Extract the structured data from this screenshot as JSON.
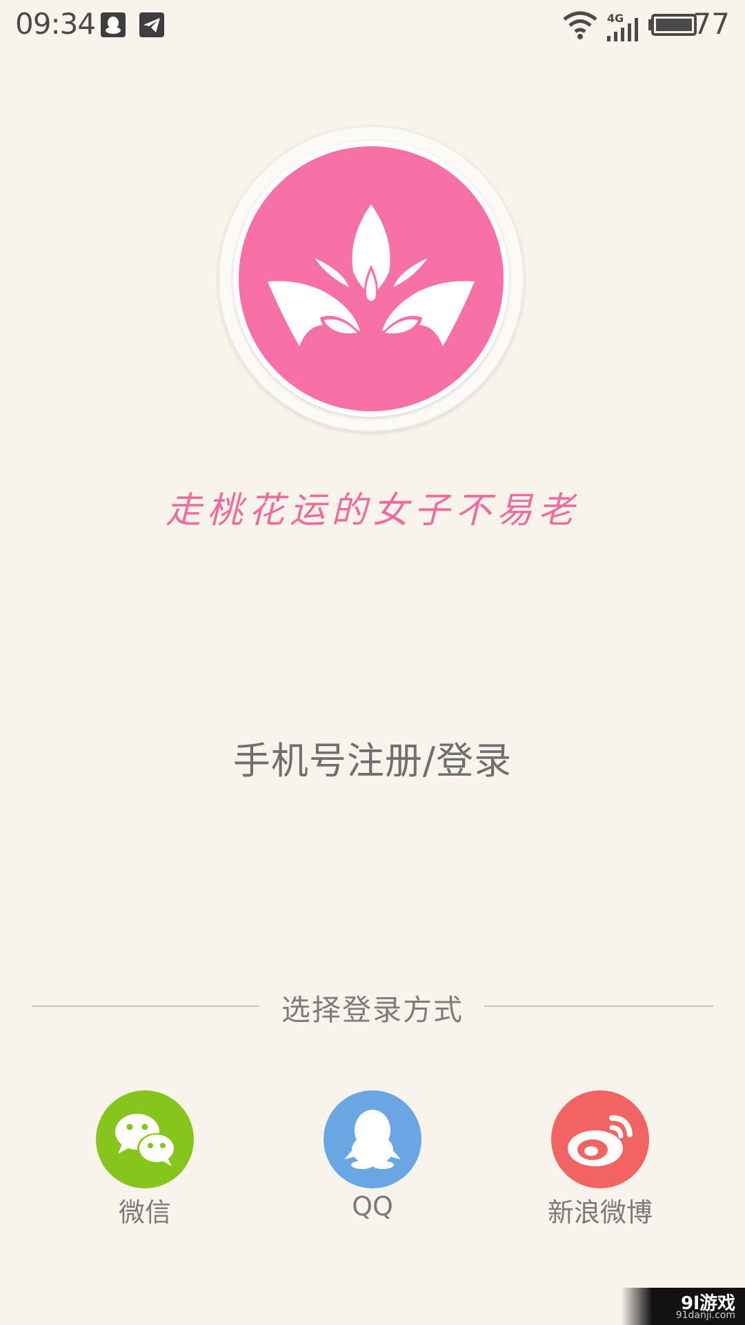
{
  "status_bar": {
    "time": "09:34",
    "network": "4G",
    "battery_level": "77",
    "icons": [
      "qq-notification-icon",
      "telegram-icon",
      "wifi-icon",
      "cellular-signal-icon",
      "battery-icon"
    ]
  },
  "logo": {
    "icon": "lotus-icon",
    "disc_color": "#f771a6"
  },
  "slogan": "走桃花运的女子不易老",
  "phone_login_label": "手机号注册/登录",
  "login_methods": {
    "title": "选择登录方式",
    "options": [
      {
        "label": "微信",
        "icon": "wechat-icon",
        "color": "#86c51b"
      },
      {
        "label": "QQ",
        "icon": "qq-icon",
        "color": "#6aa6e3"
      },
      {
        "label": "新浪微博",
        "icon": "weibo-icon",
        "color": "#f26463"
      }
    ]
  },
  "watermark": {
    "main": "9l游戏",
    "sub": "91danji.com"
  }
}
